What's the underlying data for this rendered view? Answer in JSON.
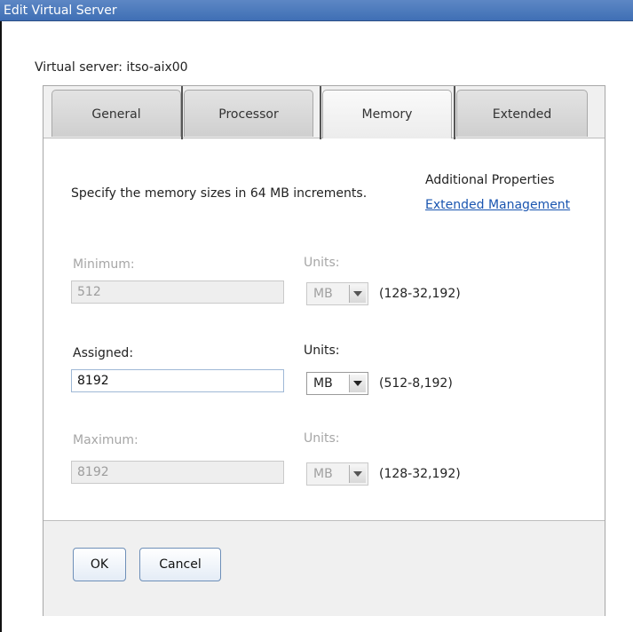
{
  "window": {
    "title": "Edit Virtual Server"
  },
  "server": {
    "label": "Virtual server: itso-aix00"
  },
  "tabs": [
    {
      "label": "General"
    },
    {
      "label": "Processor"
    },
    {
      "label": "Memory",
      "active": true
    },
    {
      "label": "Extended"
    }
  ],
  "memory": {
    "hint": "Specify the memory sizes in 64 MB increments.",
    "additional_properties": "Additional Properties",
    "extended_management_link": "Extended Management",
    "minimum": {
      "label": "Minimum:",
      "value": "512",
      "units_label": "Units:",
      "units_value": "MB",
      "range": "(128-32,192)",
      "enabled": false
    },
    "assigned": {
      "label": "Assigned:",
      "value": "8192",
      "units_label": "Units:",
      "units_value": "MB",
      "range": "(512-8,192)",
      "enabled": true
    },
    "maximum": {
      "label": "Maximum:",
      "value": "8192",
      "units_label": "Units:",
      "units_value": "MB",
      "range": "(128-32,192)",
      "enabled": false
    }
  },
  "footer": {
    "ok_label": "OK",
    "cancel_label": "Cancel"
  },
  "colors": {
    "titlebar": "#3f6fb5",
    "link": "#1a55b0",
    "input_border": "#9fb8d6"
  }
}
